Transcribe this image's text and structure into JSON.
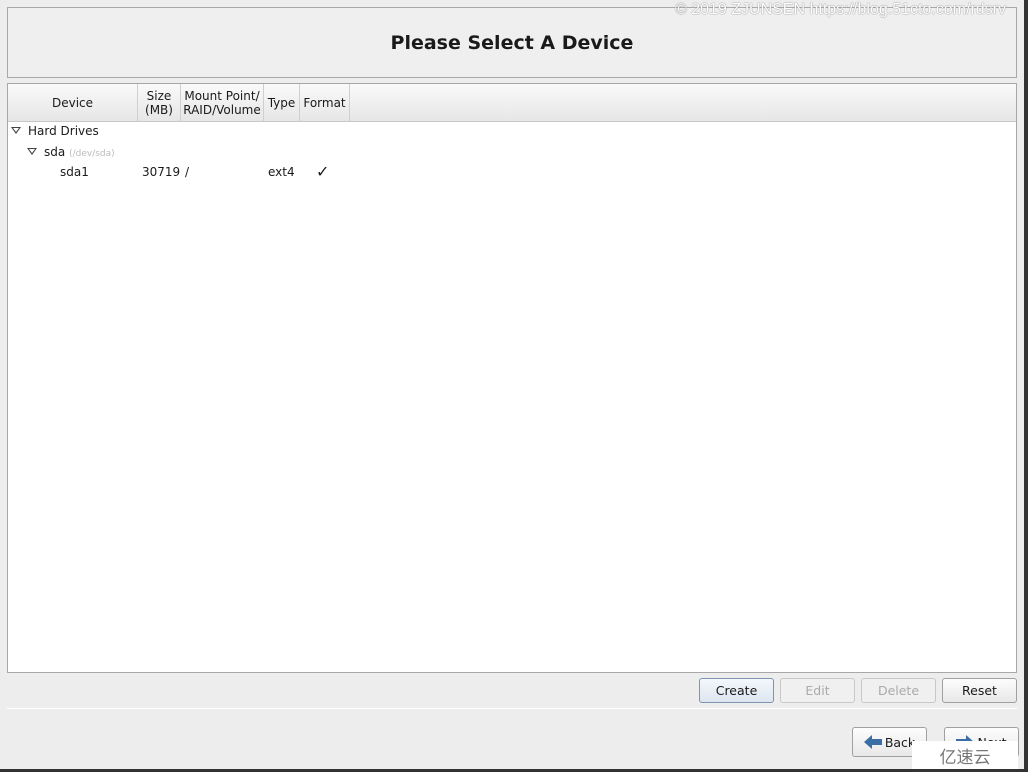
{
  "header": {
    "title": "Please Select A Device"
  },
  "watermark": "© 2019 ZJUNSEN https://blog.51cto.com/rdsrv",
  "logo_text": "亿速云",
  "columns": [
    "Device",
    "Size\n(MB)",
    "Mount Point/\nRAID/Volume",
    "Type",
    "Format"
  ],
  "tree": {
    "group": "Hard Drives",
    "disk": {
      "name": "sda",
      "path": "(/dev/sda)"
    },
    "partition": {
      "name": "sda1",
      "size": "30719",
      "mount": "/",
      "type": "ext4",
      "format": "✓"
    }
  },
  "buttons": {
    "create": "Create",
    "edit": "Edit",
    "delete": "Delete",
    "reset": "Reset",
    "back": "Back",
    "next": "Next"
  },
  "accent": "#3a6ea5"
}
